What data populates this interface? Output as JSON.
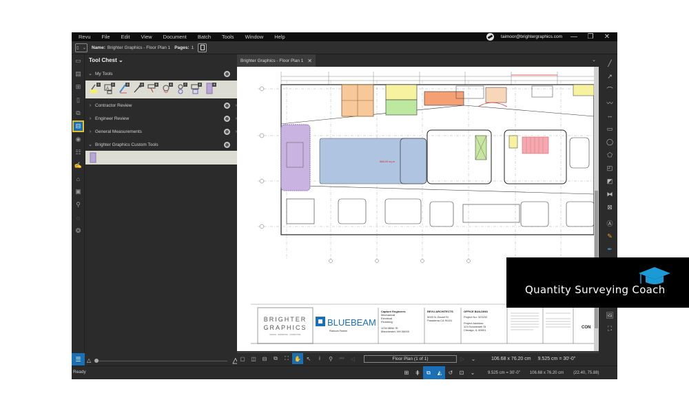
{
  "menubar": {
    "items": [
      "Revu",
      "File",
      "Edit",
      "View",
      "Document",
      "Batch",
      "Tools",
      "Window",
      "Help"
    ],
    "user_email": "taimoor@brightergraphics.com",
    "window_controls": [
      "minimize-icon",
      "restore-icon",
      "close-icon"
    ]
  },
  "docbar": {
    "name_label": "Name:",
    "name_value": "Brighter Graphics - Floor Plan 1",
    "pages_label": "Pages:",
    "pages_value": "1"
  },
  "left_rail": {
    "icons": [
      "thumbnails-icon",
      "layers-icon",
      "grid-icon",
      "bookmarks-icon",
      "file-access-icon",
      "tool-chest-icon",
      "properties-icon",
      "markups-list-icon",
      "signatures-icon",
      "tags-icon",
      "measurements-icon",
      "search-icon",
      "links-icon",
      "sets-icon"
    ],
    "active": "tool-chest-icon",
    "bottom_icon": "list-icon"
  },
  "tool_chest": {
    "title": "Tool Chest",
    "sections": [
      {
        "label": "My Tools",
        "expanded": true
      },
      {
        "label": "Contractor Review",
        "expanded": false
      },
      {
        "label": "Engineer Review",
        "expanded": false
      },
      {
        "label": "General Measurements",
        "expanded": false
      },
      {
        "label": "Brighter Graphics Custom Tools",
        "expanded": true
      }
    ],
    "my_tools": [
      "highlight-tool",
      "text-box-tool",
      "pen-tool",
      "arrow-tool",
      "callout-tool",
      "cloud-tool",
      "ellipse-tool",
      "rectangle-tool",
      "area-tool"
    ]
  },
  "document": {
    "tab_title": "Brighter Graphics - Floor Plan 1",
    "area_label": "566.09 sq m",
    "title_block": {
      "company1": "BRIGHTER",
      "company2": "GRAPHICS",
      "tagline": "DESIGN · MARKETING · CONSULTING",
      "bluebeam": "BLUEBEAM",
      "partner": "Platinum Partner",
      "engineer_name": "Capture Engineers",
      "engineer_disciplines": [
        "Mechanical",
        "Electrical",
        "Plumbing"
      ],
      "engineer_address": [
        "1234 Miller St",
        "Manchester, NH 06000"
      ],
      "architect_name": "REVU ARCHITECTS",
      "architect_address": [
        "5000 N. Broad St",
        "Pasadena CA 91101"
      ],
      "project_name": "OFFICE BUILDING",
      "project_no": "Project No: 323232",
      "project_address_label": "Project Address:",
      "project_address": [
        "123 Schomwell St",
        "Chicago, IL 60601"
      ],
      "sheet_label": "CON"
    }
  },
  "doc_toolbar": {
    "page_field": "Floor Plan (1 of 1)",
    "dimensions": "106.68 x 76.20 cm",
    "scale": "9.525 cm = 30'-0\""
  },
  "statusbar": {
    "ready": "Ready",
    "scale": "9.525 cm = 30'-0\"",
    "dimensions": "106.68 x 76.20 cm",
    "coordinates": "(22.40, 75.88)"
  },
  "overlay": {
    "text": "Quantity Surveying Coach",
    "accent": "#1b9ad6"
  },
  "colors": {
    "accent": "#1a6fb5",
    "highlight": "#e8c020"
  }
}
